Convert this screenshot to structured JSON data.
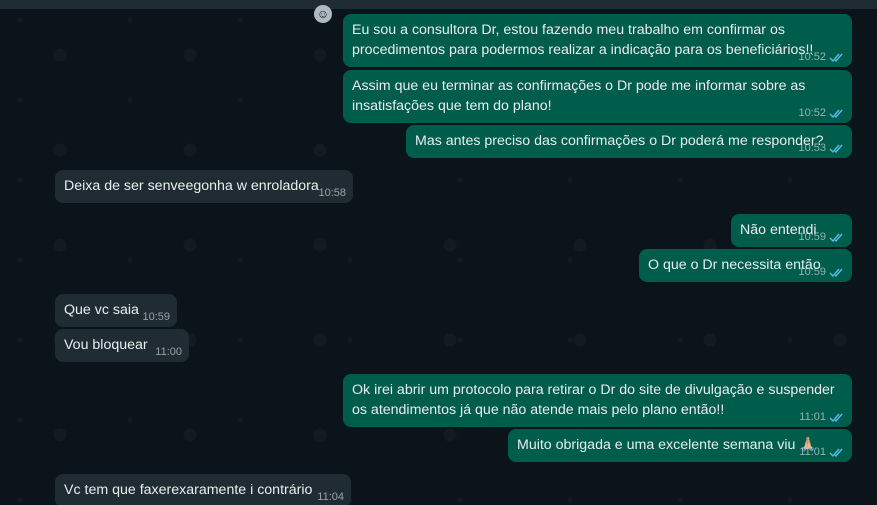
{
  "messages": [
    {
      "dir": "out",
      "text": "Eu sou a consultora Dr, estou fazendo meu trabalho em confirmar os procedimentos para podermos realizar a indicação para os beneficiários!!",
      "time": "10:52"
    },
    {
      "dir": "out",
      "text": "Assim que eu terminar as confirmações o Dr pode me informar sobre as insatisfações que tem do plano!",
      "time": "10:52"
    },
    {
      "dir": "out",
      "text": "Mas antes preciso das confirmações o Dr poderá me responder?",
      "time": "10:53"
    },
    {
      "dir": "in",
      "text": "Deixa de ser senveegonha w enroladora",
      "time": "10:58"
    },
    {
      "dir": "out",
      "text": "Não entendi",
      "time": "10:59"
    },
    {
      "dir": "out",
      "text": "O que o Dr necessita então",
      "time": "10:59"
    },
    {
      "dir": "in",
      "text": "Que vc saia",
      "time": "10:59"
    },
    {
      "dir": "in",
      "text": "Vou bloquear",
      "time": "11:00"
    },
    {
      "dir": "out",
      "text": "Ok irei abrir um protocolo para retirar o Dr do site de divulgação e suspender os atendimentos já que não atende mais pelo plano então!!",
      "time": "11:01"
    },
    {
      "dir": "out",
      "text": "Muito obrigada e uma excelente semana viu 🙏🏼",
      "time": "11:01"
    },
    {
      "dir": "in",
      "text": "Vc tem que faxerexaramente i contrário",
      "time": "11:04"
    }
  ],
  "colors": {
    "background": "#0b141a",
    "outgoing_bubble": "#005c4b",
    "incoming_bubble": "#202c33",
    "read_tick": "#53bdeb"
  },
  "icons": {
    "emoji_button": "smiley-icon",
    "status": "double-check-icon"
  }
}
